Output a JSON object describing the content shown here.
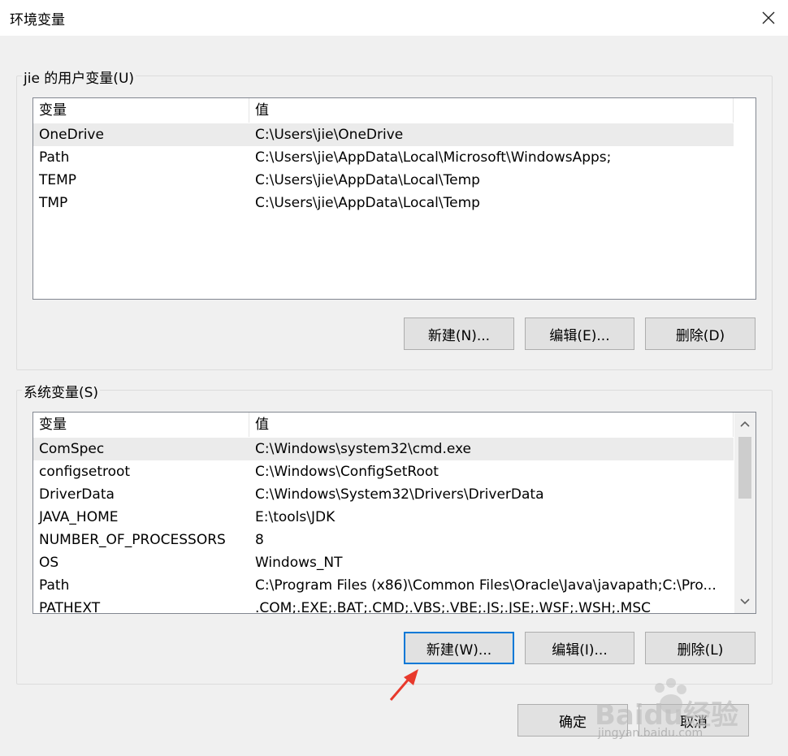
{
  "window": {
    "title": "环境变量"
  },
  "user_vars": {
    "group_label": "jie 的用户变量(U)",
    "headers": {
      "name": "变量",
      "value": "值"
    },
    "rows": [
      {
        "name": "OneDrive",
        "value": "C:\\Users\\jie\\OneDrive"
      },
      {
        "name": "Path",
        "value": "C:\\Users\\jie\\AppData\\Local\\Microsoft\\WindowsApps;"
      },
      {
        "name": "TEMP",
        "value": "C:\\Users\\jie\\AppData\\Local\\Temp"
      },
      {
        "name": "TMP",
        "value": "C:\\Users\\jie\\AppData\\Local\\Temp"
      }
    ],
    "buttons": {
      "new": "新建(N)...",
      "edit": "编辑(E)...",
      "delete": "删除(D)"
    }
  },
  "system_vars": {
    "group_label": "系统变量(S)",
    "headers": {
      "name": "变量",
      "value": "值"
    },
    "rows": [
      {
        "name": "ComSpec",
        "value": "C:\\Windows\\system32\\cmd.exe"
      },
      {
        "name": "configsetroot",
        "value": "C:\\Windows\\ConfigSetRoot"
      },
      {
        "name": "DriverData",
        "value": "C:\\Windows\\System32\\Drivers\\DriverData"
      },
      {
        "name": "JAVA_HOME",
        "value": "E:\\tools\\JDK"
      },
      {
        "name": "NUMBER_OF_PROCESSORS",
        "value": "8"
      },
      {
        "name": "OS",
        "value": "Windows_NT"
      },
      {
        "name": "Path",
        "value": "C:\\Program Files (x86)\\Common Files\\Oracle\\Java\\javapath;C:\\Pro..."
      },
      {
        "name": "PATHEXT",
        "value": ".COM;.EXE;.BAT;.CMD;.VBS;.VBE;.JS;.JSE;.WSF;.WSH;.MSC"
      }
    ],
    "buttons": {
      "new": "新建(W)...",
      "edit": "编辑(I)...",
      "delete": "删除(L)"
    }
  },
  "footer": {
    "ok": "确定",
    "cancel": "取消"
  },
  "watermark": {
    "text": "Baidu经验",
    "url": "jingyan.baidu.com"
  },
  "colors": {
    "default_button_border": "#0078d7",
    "arrow": "#e8392c"
  },
  "icons": {
    "close": "close-icon",
    "scroll_up": "chevron-up-icon",
    "scroll_down": "chevron-down-icon",
    "arrow": "annotation-arrow-icon"
  }
}
